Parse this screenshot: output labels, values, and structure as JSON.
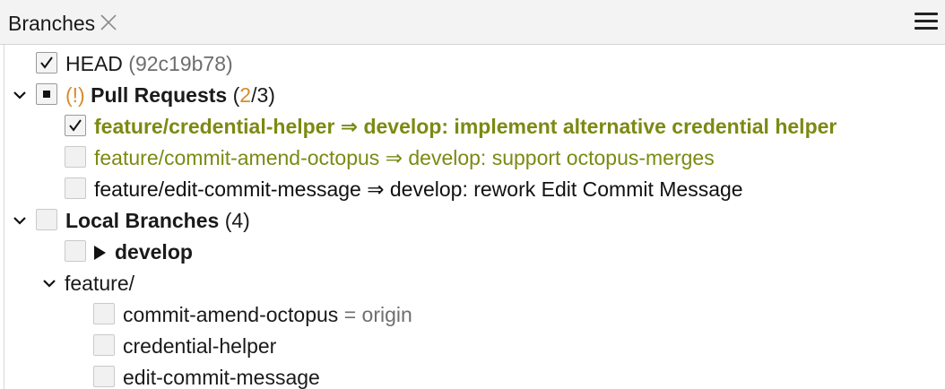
{
  "header": {
    "tab_label": "Branches",
    "close_icon": "close-icon",
    "menu_icon": "hamburger-menu-icon"
  },
  "tree": {
    "head": {
      "label": "HEAD",
      "hash": "(92c19b78)",
      "checked": true
    },
    "pull_requests": {
      "warning": "(!)",
      "label": "Pull Requests",
      "count_open": "(",
      "count_selected": "2",
      "count_rest": "/3)",
      "state": "partial",
      "items": [
        {
          "text": "feature/credential-helper ⇒ develop: implement alternative credential helper",
          "checked": true,
          "style": "olive-bold"
        },
        {
          "text": "feature/commit-amend-octopus ⇒ develop: support octopus-merges",
          "checked": false,
          "style": "olive"
        },
        {
          "text": "feature/edit-commit-message ⇒ develop: rework Edit Commit Message",
          "checked": false,
          "style": "normal"
        }
      ]
    },
    "local_branches": {
      "label": "Local Branches",
      "count": "(4)",
      "develop": {
        "label": "develop",
        "current": true
      },
      "feature_folder": {
        "label": "feature/",
        "items": [
          {
            "name": "commit-amend-octopus",
            "suffix": "= origin"
          },
          {
            "name": "credential-helper",
            "suffix": ""
          },
          {
            "name": "edit-commit-message",
            "suffix": ""
          }
        ]
      }
    }
  },
  "colors": {
    "olive": "#7b8a12",
    "orange": "#d98a2b",
    "gray": "#6e6e6e"
  }
}
